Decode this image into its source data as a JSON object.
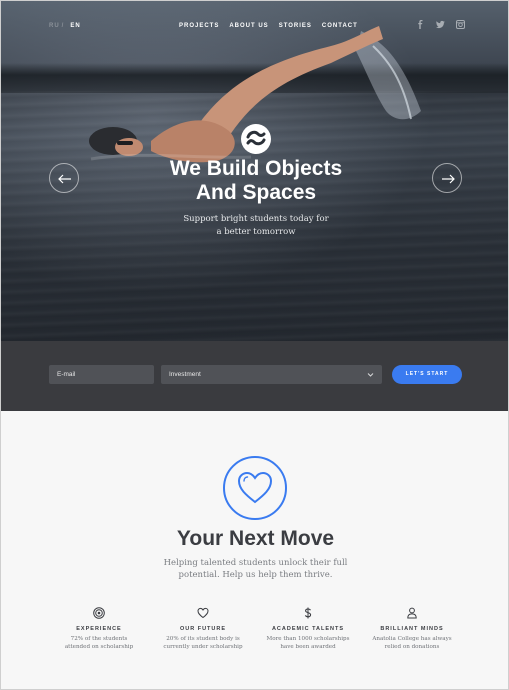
{
  "header": {
    "languages": [
      "RU",
      "EN"
    ],
    "active_language": "EN",
    "separator": "/",
    "nav": [
      "PROJECTS",
      "ABOUT US",
      "STORIES",
      "CONTACT"
    ],
    "social_icons": [
      "facebook-icon",
      "twitter-icon",
      "instagram-icon"
    ]
  },
  "hero": {
    "title_line1": "We Build Objects",
    "title_line2": "And Spaces",
    "subtitle_line1": "Support bright students today for",
    "subtitle_line2": "a better tomorrow",
    "logo_icon": "wave-logo-icon",
    "prev_icon": "arrow-left-icon",
    "next_icon": "arrow-right-icon"
  },
  "form": {
    "email_placeholder": "E-mail",
    "select_value": "Investment",
    "button_label": "LET'S START"
  },
  "intro": {
    "icon": "heart-icon",
    "title": "Your Next Move",
    "subtitle_line1": "Helping talented students unlock their full",
    "subtitle_line2": "potential. Help us help them thrive."
  },
  "features": [
    {
      "icon": "target-icon",
      "title": "EXPERIENCE",
      "line1": "72% of the students",
      "line2": "attended on scholarship"
    },
    {
      "icon": "heart-outline-icon",
      "title": "OUR FUTURE",
      "line1": "20% of its student body is",
      "line2": "currently under scholarship"
    },
    {
      "icon": "dollar-icon",
      "title": "ACADEMIC TALENTS",
      "line1": "More than 1000 scholarships",
      "line2": "have been awarded"
    },
    {
      "icon": "person-icon",
      "title": "BRILLIANT MINDS",
      "line1": "Anatolia College has always",
      "line2": "relied on donations"
    }
  ],
  "colors": {
    "accent": "#3a7bf0",
    "form_bar": "#3a3b3f",
    "heading": "#3b3d42"
  }
}
